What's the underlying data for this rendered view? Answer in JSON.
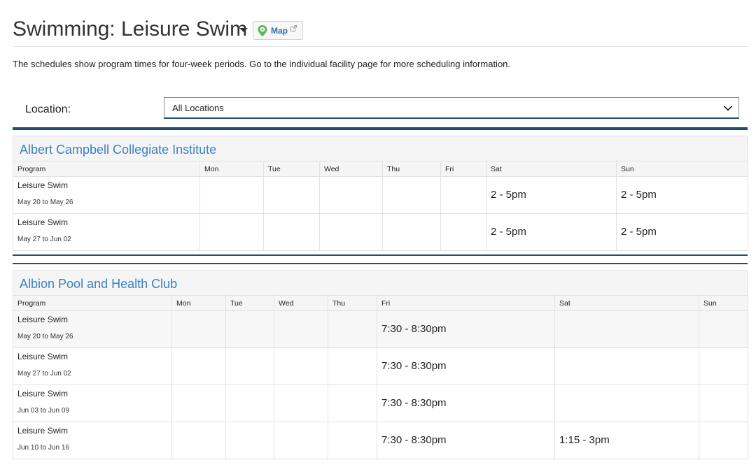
{
  "header": {
    "title": "Swimming: Leisure Swim",
    "map_label": "Map"
  },
  "intro": "The schedules show program times for four-week periods. Go to the individual facility page for more scheduling information.",
  "location": {
    "label": "Location:",
    "selected": "All Locations"
  },
  "facilities": [
    {
      "name": "Albert Campbell Collegiate Institute",
      "columns": [
        "Program",
        "Mon",
        "Tue",
        "Wed",
        "Thu",
        "Fri",
        "Sat",
        "Sun"
      ],
      "rows": [
        {
          "program": "Leisure Swim",
          "dates": "May 20 to May 26",
          "mon": "",
          "tue": "",
          "wed": "",
          "thu": "",
          "fri": "",
          "sat": "2 - 5pm",
          "sun": "2 - 5pm"
        },
        {
          "program": "Leisure Swim",
          "dates": "May 27 to Jun 02",
          "mon": "",
          "tue": "",
          "wed": "",
          "thu": "",
          "fri": "",
          "sat": "2 - 5pm",
          "sun": "2 - 5pm"
        }
      ]
    },
    {
      "name": "Albion Pool and Health Club",
      "columns": [
        "Program",
        "Mon",
        "Tue",
        "Wed",
        "Thu",
        "Fri",
        "Sat",
        "Sun"
      ],
      "rows": [
        {
          "program": "Leisure Swim",
          "dates": "May 20 to May 26",
          "mon": "",
          "tue": "",
          "wed": "",
          "thu": "",
          "fri": "7:30 - 8:30pm",
          "sat": "",
          "sun": ""
        },
        {
          "program": "Leisure Swim",
          "dates": "May 27 to Jun 02",
          "mon": "",
          "tue": "",
          "wed": "",
          "thu": "",
          "fri": "7:30 - 8:30pm",
          "sat": "",
          "sun": ""
        },
        {
          "program": "Leisure Swim",
          "dates": "Jun 03 to Jun 09",
          "mon": "",
          "tue": "",
          "wed": "",
          "thu": "",
          "fri": "7:30 - 8:30pm",
          "sat": "",
          "sun": ""
        },
        {
          "program": "Leisure Swim",
          "dates": "Jun 10 to Jun 16",
          "mon": "",
          "tue": "",
          "wed": "",
          "thu": "",
          "fri": "7:30 - 8:30pm",
          "sat": "1:15 - 3pm",
          "sun": ""
        }
      ]
    }
  ],
  "colors": {
    "link_blue": "#3a82c4",
    "rule_navy": "#1f4e79",
    "pin_green": "#5cb85c"
  }
}
